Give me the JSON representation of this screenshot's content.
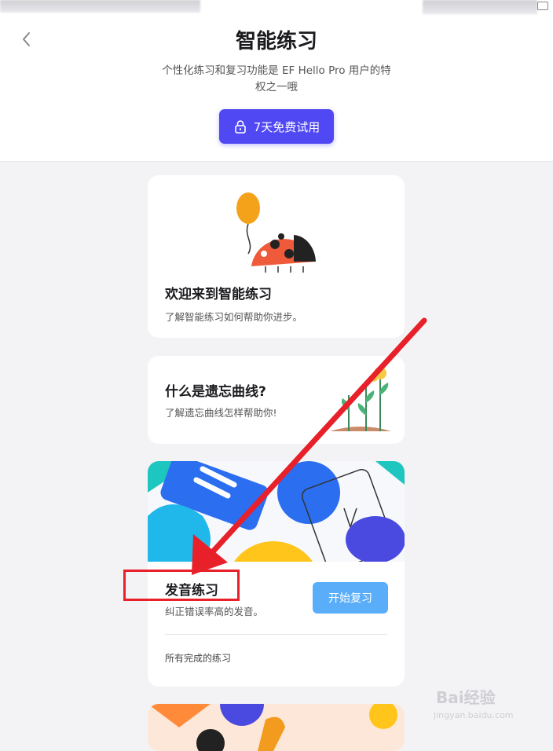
{
  "header": {
    "title": "智能练习",
    "subtitle": "个性化练习和复习功能是 EF Hello Pro 用户的特权之一哦",
    "trial_button": "7天免费试用",
    "back_icon": "chevron-left-icon"
  },
  "cards": [
    {
      "title": "欢迎来到智能练习",
      "desc": "了解智能练习如何帮助你进步。",
      "illustration": "ladybug-balloon"
    },
    {
      "title": "什么是遗忘曲线?",
      "desc": "了解遗忘曲线怎样帮助你!",
      "illustration": "growing-plants"
    },
    {
      "title": "发音练习",
      "desc": "纠正错误率高的发音。",
      "button": "开始复习",
      "footer_label": "所有完成的练习"
    }
  ],
  "watermark": {
    "text": "Bai经验",
    "sub": "jingyan.baidu.com"
  },
  "colors": {
    "accent": "#5048f2",
    "start_button": "#5aaef9",
    "annotation": "#e8202a"
  }
}
